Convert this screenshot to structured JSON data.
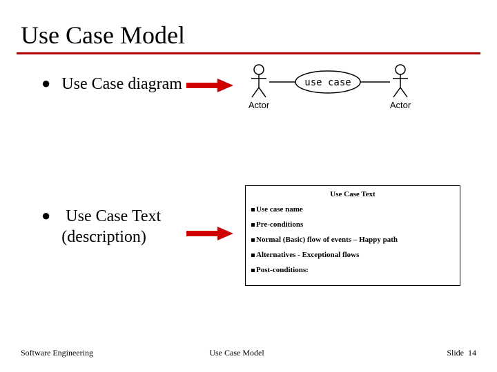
{
  "title": "Use Case Model",
  "bullets": {
    "b1": "Use Case diagram",
    "b2_line1": "Use Case Text",
    "b2_line2": "(description)"
  },
  "diagram": {
    "actor_left": "Actor",
    "actor_right": "Actor",
    "usecase": "use case"
  },
  "textbox": {
    "title": "Use Case Text",
    "items": [
      "Use case name",
      "Pre-conditions",
      "Normal (Basic) flow of events – Happy path",
      "Alternatives - Exceptional  flows",
      "Post-conditions:"
    ]
  },
  "footer": {
    "left": "Software Engineering",
    "center": "Use Case Model",
    "right_label": "Slide",
    "right_num": "14"
  }
}
